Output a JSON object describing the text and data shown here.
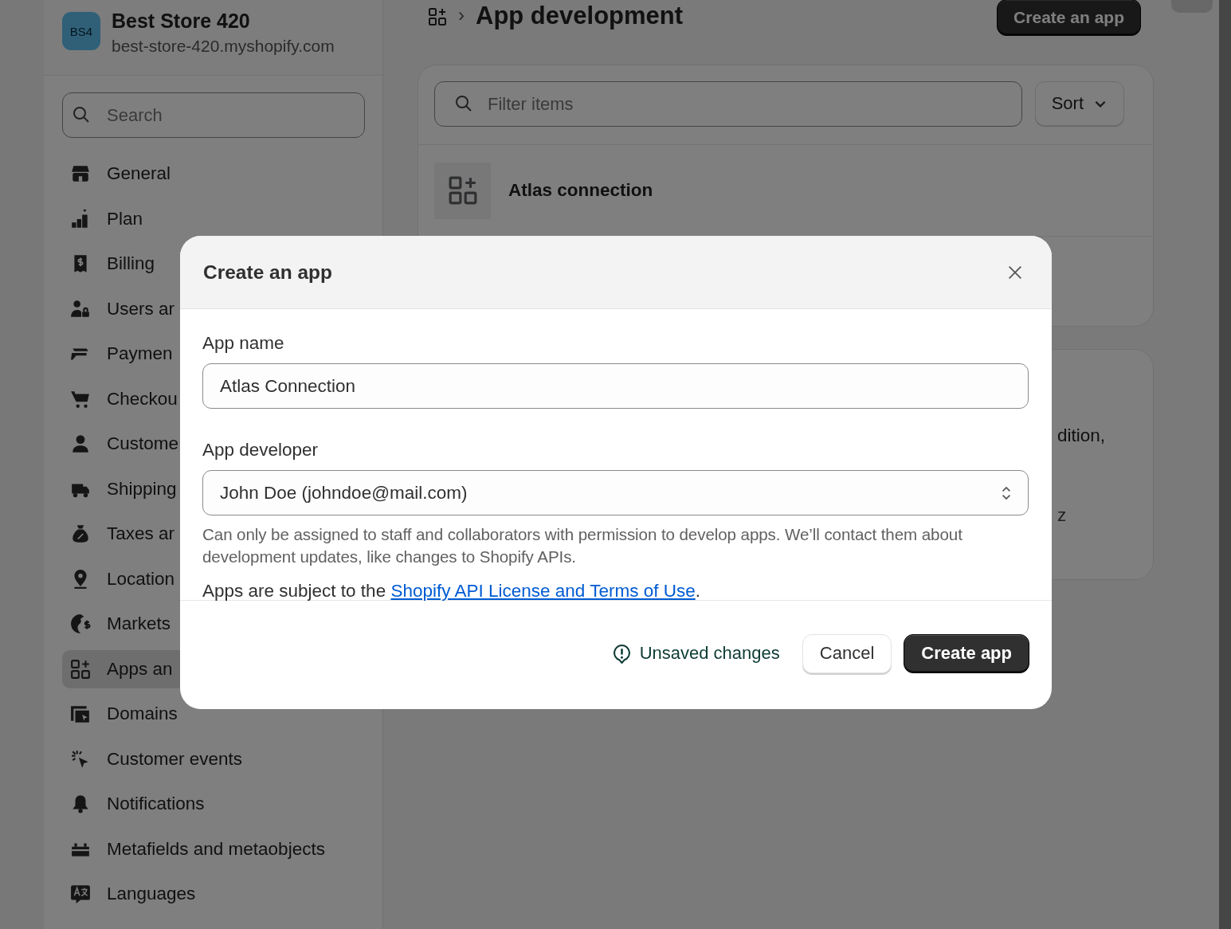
{
  "store": {
    "avatar": "BS4",
    "name": "Best Store 420",
    "domain": "best-store-420.myshopify.com"
  },
  "sidebar": {
    "search": {
      "placeholder": "Search"
    },
    "items": [
      {
        "label": "General",
        "selected": false
      },
      {
        "label": "Plan",
        "selected": false
      },
      {
        "label": "Billing",
        "selected": false
      },
      {
        "label": "Users ar",
        "selected": false
      },
      {
        "label": "Paymen",
        "selected": false
      },
      {
        "label": "Checkou",
        "selected": false
      },
      {
        "label": "Custome",
        "selected": false
      },
      {
        "label": "Shipping",
        "selected": false
      },
      {
        "label": "Taxes ar",
        "selected": false
      },
      {
        "label": "Location",
        "selected": false
      },
      {
        "label": "Markets",
        "selected": false
      },
      {
        "label": "Apps an",
        "selected": true
      },
      {
        "label": "Domains",
        "selected": false
      },
      {
        "label": "Customer events",
        "selected": false
      },
      {
        "label": "Notifications",
        "selected": false
      },
      {
        "label": "Metafields and metaobjects",
        "selected": false
      },
      {
        "label": "Languages",
        "selected": false
      }
    ]
  },
  "page": {
    "breadcrumb_separator": "›",
    "title": "App development",
    "primary_action": "Create an app",
    "filter": {
      "placeholder": "Filter items"
    },
    "sort": "Sort",
    "apps": [
      {
        "name": "Atlas connection"
      }
    ],
    "info_fragments": [
      "dition,",
      "z"
    ]
  },
  "dialog": {
    "title": "Create an app",
    "app_name": {
      "label": "App name",
      "value": "Atlas Connection"
    },
    "app_developer": {
      "label": "App developer",
      "value": "John Doe (johndoe@mail.com)",
      "help": "Can only be assigned to staff and collaborators with permission to develop apps. We’ll contact them about development updates, like changes to Shopify APIs."
    },
    "terms": {
      "prefix": "Apps are subject to the ",
      "link": "Shopify API License and Terms of Use",
      "suffix": "."
    },
    "status": "Unsaved changes",
    "buttons": [
      {
        "label": "Cancel",
        "kind": "secondary"
      },
      {
        "label": "Create app",
        "kind": "primary"
      }
    ]
  }
}
